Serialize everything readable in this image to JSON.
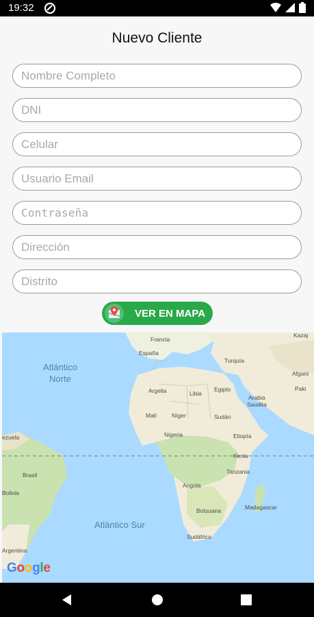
{
  "status_bar": {
    "time": "19:32"
  },
  "form": {
    "title": "Nuevo Cliente",
    "fields": {
      "nombre": "Nombre Completo",
      "dni": "DNI",
      "celular": "Celular",
      "email": "Usuario Email",
      "password": "Contraseña",
      "direccion": "Dirección",
      "distrito": "Distrito"
    },
    "map_button": "VER EN MAPA"
  },
  "map": {
    "ocean_labels": {
      "atlantico_norte_1": "Atlántico",
      "atlantico_norte_2": "Norte",
      "atlantico_sur": "Atlántico Sur"
    },
    "countries": {
      "francia": "Francia",
      "espana": "España",
      "turquia": "Turquía",
      "argelia": "Argelia",
      "libia": "Libia",
      "egipto": "Egipto",
      "arabia_1": "Arabia",
      "arabia_2": "Saudita",
      "mali": "Malí",
      "niger": "Níger",
      "sudan": "Sudán",
      "nigeria": "Nigeria",
      "etiopia": "Etiopía",
      "kenia": "Kenia",
      "tanzania": "Tanzania",
      "angola": "Angola",
      "botsuana": "Botsuana",
      "madagascar": "Madagascar",
      "sudafrica": "Sudáfrica",
      "brasil": "Brasil",
      "bolivia": "Bolivia",
      "argentina": "Argentina",
      "venezuela": "ezuela",
      "afganistan": "Afgani",
      "pakistan": "Paki",
      "kazajist": "Kazaj"
    },
    "attribution": "Google",
    "colors": {
      "water": "#aadaff",
      "land": "#f1ecd9",
      "vegetation": "#c9e2b0",
      "accent": "#29a94a"
    }
  }
}
